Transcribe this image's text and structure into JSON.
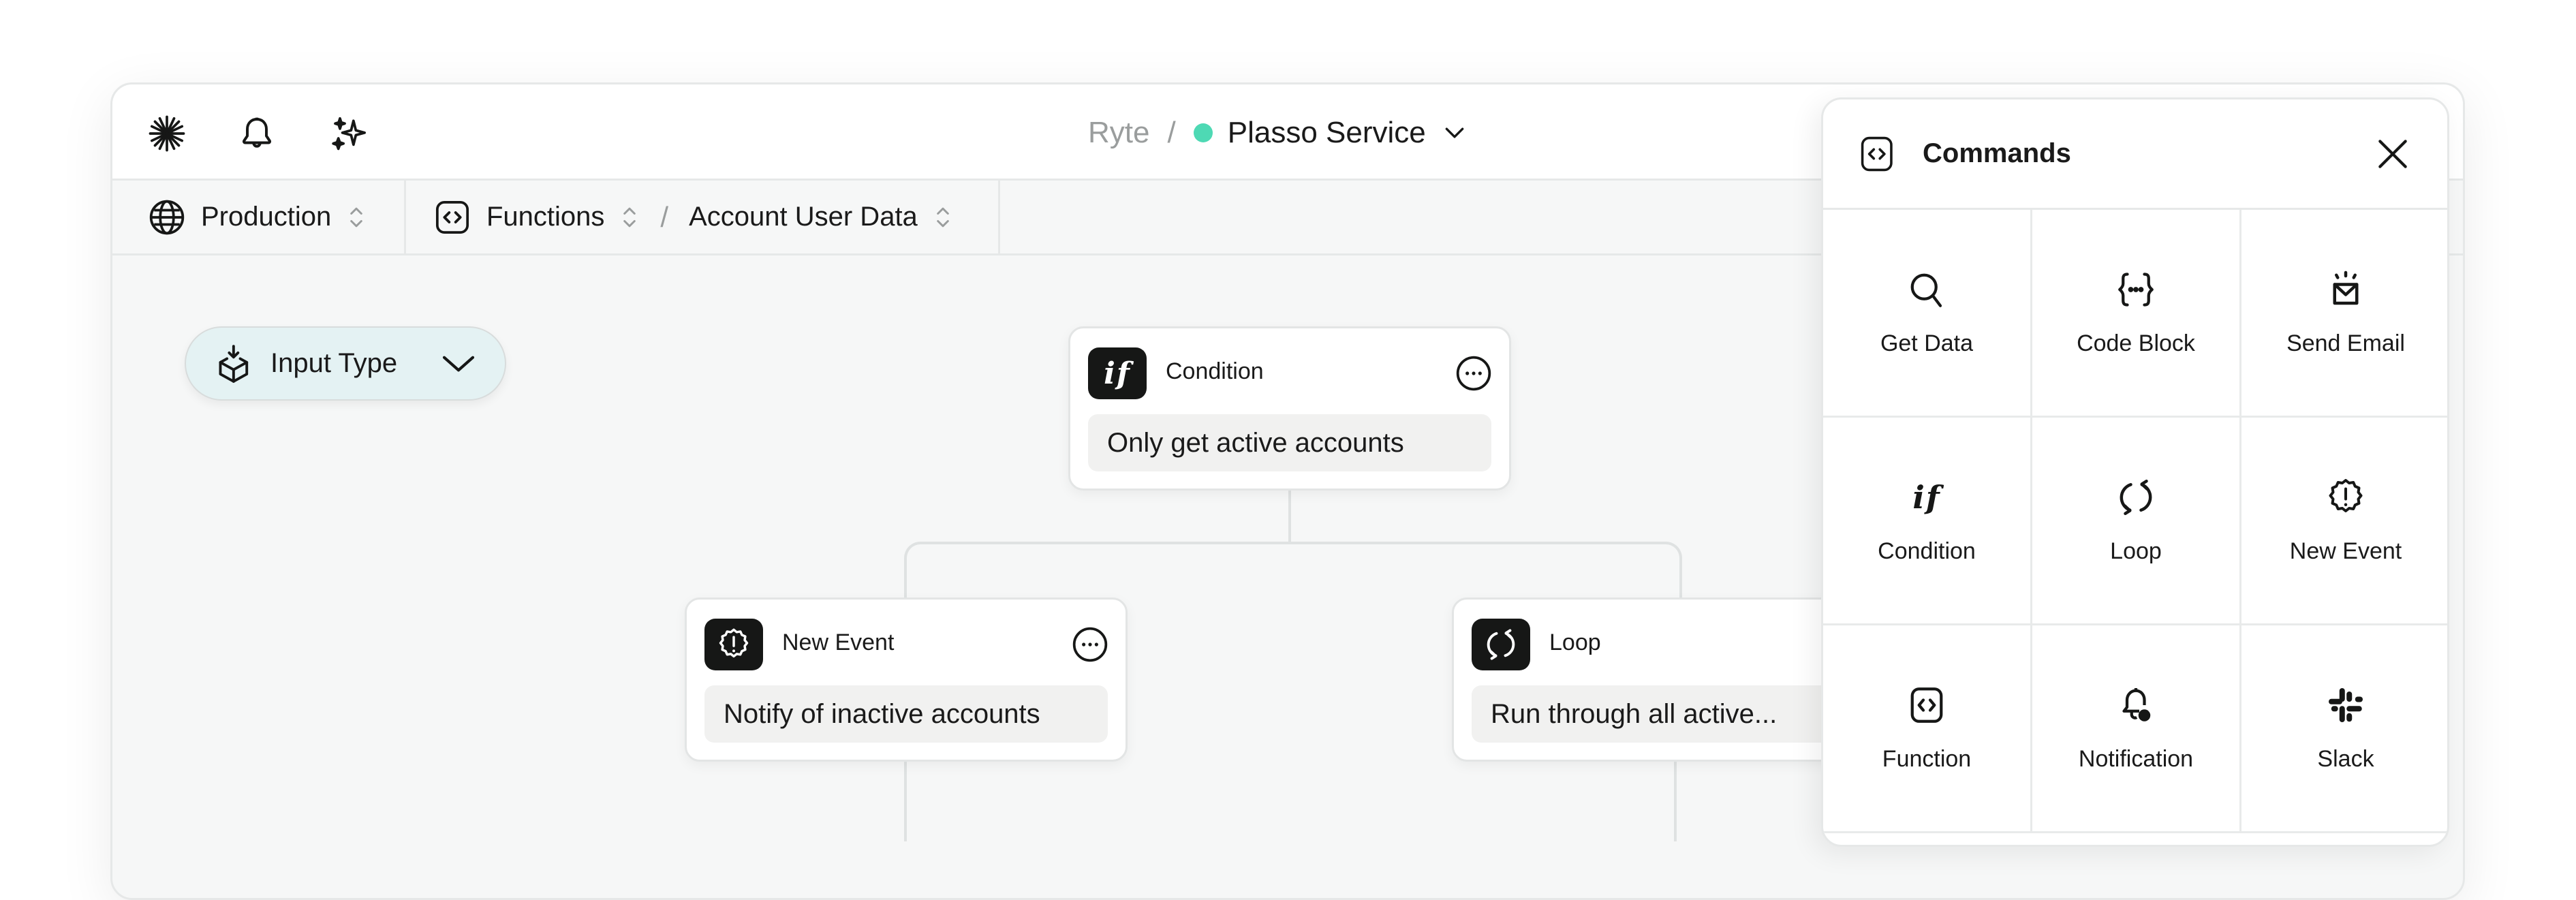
{
  "topbar": {
    "icons": [
      "sparkle-icon",
      "bell-icon",
      "stars-icon"
    ],
    "org": "Ryte",
    "separator": "/",
    "service": "Plasso Service",
    "status_color": "#4ed9b4"
  },
  "subbar": {
    "environment": "Production",
    "section": "Functions",
    "separator": "/",
    "function_name": "Account User Data"
  },
  "canvas": {
    "input_type": {
      "label": "Input Type"
    },
    "nodes": [
      {
        "type": "Condition",
        "icon": "if-icon",
        "description": "Only get active accounts"
      },
      {
        "type": "New Event",
        "icon": "alert-badge-icon",
        "description": "Notify of inactive accounts"
      },
      {
        "type": "Loop",
        "icon": "loop-icon",
        "description": "Run through all active..."
      }
    ]
  },
  "commands": {
    "title": "Commands",
    "items": [
      {
        "label": "Get Data",
        "icon": "search-icon"
      },
      {
        "label": "Code Block",
        "icon": "code-block-icon"
      },
      {
        "label": "Send Email",
        "icon": "send-email-icon"
      },
      {
        "label": "Condition",
        "icon": "if-icon"
      },
      {
        "label": "Loop",
        "icon": "loop-icon"
      },
      {
        "label": "New Event",
        "icon": "alert-badge-icon"
      },
      {
        "label": "Function",
        "icon": "function-icon"
      },
      {
        "label": "Notification",
        "icon": "notification-icon"
      },
      {
        "label": "Slack",
        "icon": "slack-icon"
      }
    ]
  },
  "colors": {
    "accent_status": "#4ed9b4",
    "pill_bg": "#e4f2f3",
    "badge_bg": "#161716"
  }
}
